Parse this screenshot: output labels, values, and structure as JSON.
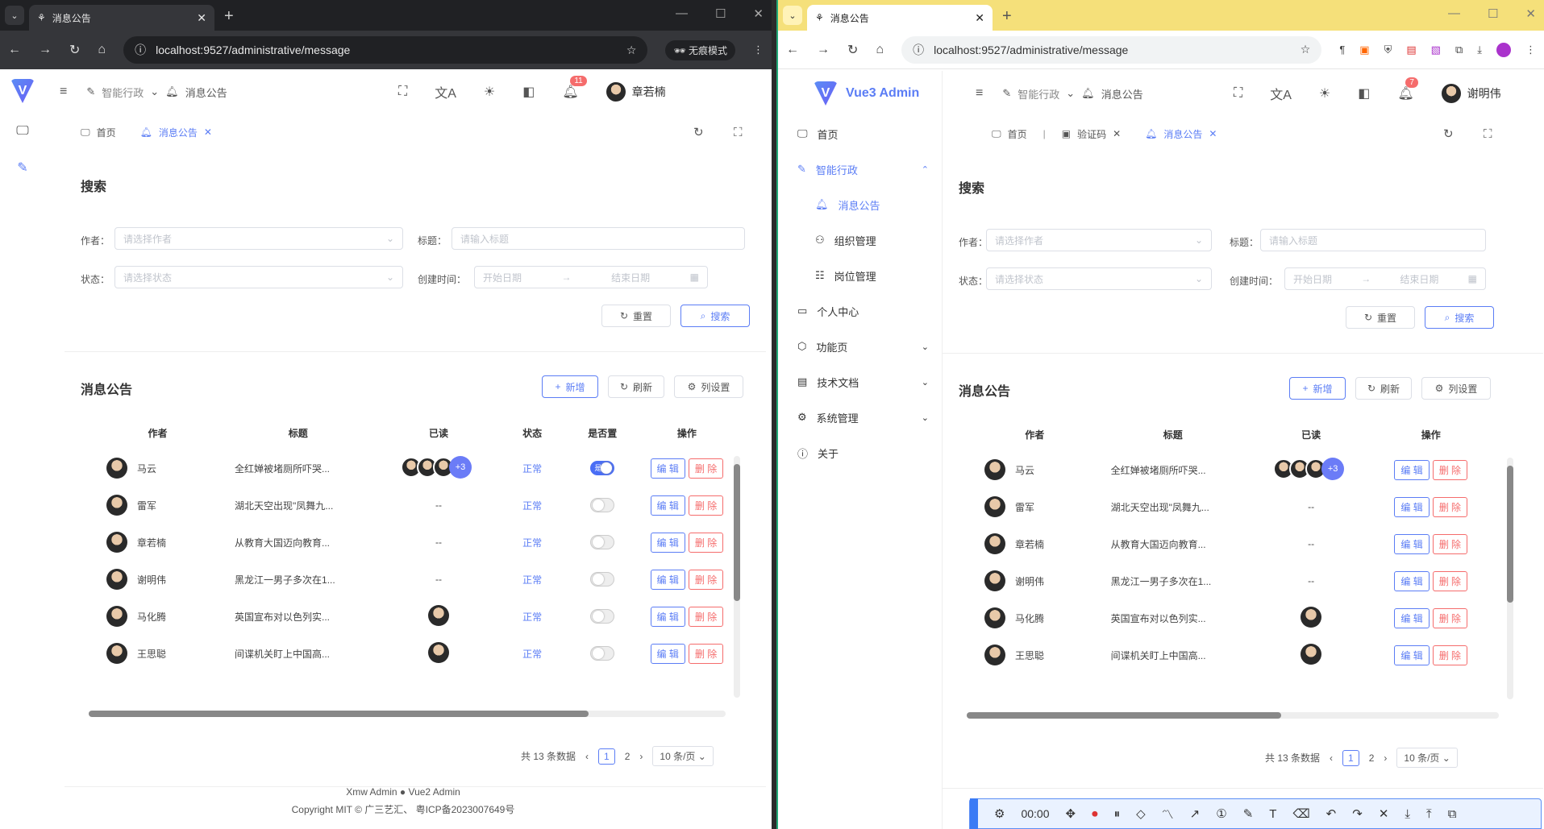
{
  "left": {
    "tab_title": "消息公告",
    "url": "localhost:9527/administrative/message",
    "incognito": "无痕模式",
    "crumb1": "智能行政",
    "crumb2": "消息公告",
    "user": "章若楠",
    "bell_count": "11",
    "tags": [
      "首页",
      "消息公告"
    ]
  },
  "right": {
    "tab_title": "消息公告",
    "url": "localhost:9527/administrative/message",
    "crumb1": "智能行政",
    "crumb2": "消息公告",
    "user": "谢明伟",
    "bell_count": "7",
    "tags": [
      "首页",
      "验证码",
      "消息公告"
    ],
    "brand": "Vue3 Admin",
    "menu": [
      {
        "label": "首页"
      },
      {
        "label": "智能行政"
      },
      {
        "label": "消息公告"
      },
      {
        "label": "组织管理"
      },
      {
        "label": "岗位管理"
      },
      {
        "label": "个人中心"
      },
      {
        "label": "功能页"
      },
      {
        "label": "技术文档"
      },
      {
        "label": "系统管理"
      },
      {
        "label": "关于"
      }
    ],
    "timer": "00:00"
  },
  "search": {
    "title": "搜索",
    "author_label": "作者：",
    "author_ph": "请选择作者",
    "title_label": "标题：",
    "title_ph": "请输入标题",
    "status_label": "状态：",
    "status_ph": "请选择状态",
    "created_label": "创建时间：",
    "start_ph": "开始日期",
    "end_ph": "结束日期",
    "reset": "重置",
    "search": "搜索"
  },
  "list": {
    "title": "消息公告",
    "add": "新增",
    "refresh": "刷新",
    "cols": "列设置",
    "headers": [
      "作者",
      "标题",
      "已读",
      "状态",
      "是否置",
      "操作"
    ],
    "rows": [
      {
        "author": "马云",
        "title": "全红婵被堵厕所吓哭...",
        "read": "",
        "status": "正常",
        "pin": "是"
      },
      {
        "author": "雷军",
        "title": "湖北天空出现\"凤舞九...",
        "read": "--",
        "status": "正常",
        "pin": "否"
      },
      {
        "author": "章若楠",
        "title": "从教育大国迈向教育...",
        "read": "--",
        "status": "正常",
        "pin": "否"
      },
      {
        "author": "谢明伟",
        "title": "黑龙江一男子多次在1...",
        "read": "--",
        "status": "正常",
        "pin": "否"
      },
      {
        "author": "马化腾",
        "title": "英国宣布对以色列实...",
        "read": "",
        "status": "正常",
        "pin": "否"
      },
      {
        "author": "王思聪",
        "title": "间谍机关盯上中国高...",
        "read": "",
        "status": "正常",
        "pin": "否"
      }
    ],
    "plus": "+3",
    "edit": "编 辑",
    "del": "删 除",
    "total": "共 13 条数据",
    "page1": "1",
    "page2": "2",
    "psize": "10 条/页"
  },
  "footer": {
    "line1a": "Xmw Admin",
    "line1b": "Vue2 Admin",
    "line2": "Copyright MIT © 广三艺汇、 粤ICP备2023007649号"
  }
}
